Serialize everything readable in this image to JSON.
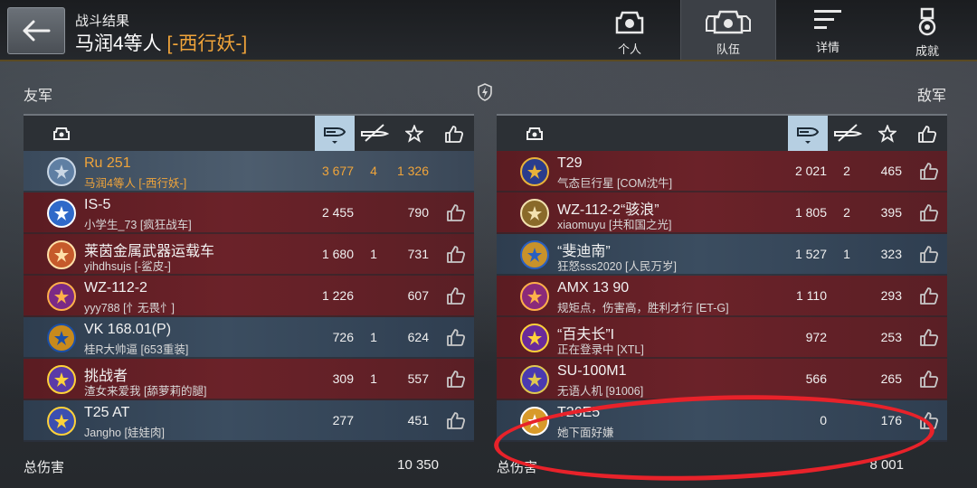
{
  "header": {
    "subtitle": "战斗结果",
    "title": "马润4等人",
    "title_clan": "[-西行妖-]"
  },
  "nav": [
    {
      "label": "个人",
      "icon": "personal-icon"
    },
    {
      "label": "队伍",
      "icon": "team-icon",
      "active": true
    },
    {
      "label": "详情",
      "icon": "details-icon"
    },
    {
      "label": "成就",
      "icon": "achievement-icon"
    }
  ],
  "allies": {
    "title": "友军",
    "rows": [
      {
        "tank": "Ru 251",
        "player": "马润4等人 [-西行妖-]",
        "damage": "3 677",
        "kills": "4",
        "xp": "1 326",
        "style": "gold"
      },
      {
        "tank": "IS-5",
        "player": "小学生_73 [疯狂战车]",
        "damage": "2 455",
        "kills": "",
        "xp": "790",
        "style": "red"
      },
      {
        "tank": "莱茵金属武器运载车",
        "player": "yihdhsujs [-鲨皮-]",
        "damage": "1 680",
        "kills": "1",
        "xp": "731",
        "style": "red"
      },
      {
        "tank": "WZ-112-2",
        "player": "yyy788 [忄无畏忄]",
        "damage": "1 226",
        "kills": "",
        "xp": "607",
        "style": "red"
      },
      {
        "tank": "VK 168.01(P)",
        "player": "桂R大帅逼 [653重装]",
        "damage": "726",
        "kills": "1",
        "xp": "624",
        "style": "blue"
      },
      {
        "tank": "挑战者",
        "player": "渣女来爱我 [舔萝莉的腿]",
        "damage": "309",
        "kills": "1",
        "xp": "557",
        "style": "red"
      },
      {
        "tank": "T25 AT",
        "player": "Jangho [娃娃肉]",
        "damage": "277",
        "kills": "",
        "xp": "451",
        "style": "blue"
      }
    ],
    "total_label": "总伤害",
    "total_value": "10 350"
  },
  "enemies": {
    "title": "敌军",
    "rows": [
      {
        "tank": "T29",
        "player": "气态巨行星 [COM沈牛]",
        "damage": "2 021",
        "kills": "2",
        "xp": "465",
        "style": "red"
      },
      {
        "tank": "WZ-112-2“骇浪”",
        "player": "xiaomuyu [共和国之光]",
        "damage": "1 805",
        "kills": "2",
        "xp": "395",
        "style": "red"
      },
      {
        "tank": "“斐迪南”",
        "player": "狂怒sss2020 [人民万岁]",
        "damage": "1 527",
        "kills": "1",
        "xp": "323",
        "style": "blue"
      },
      {
        "tank": "AMX 13 90",
        "player": "规矩点，伤害高，胜利才行 [ET-G]",
        "damage": "1 110",
        "kills": "",
        "xp": "293",
        "style": "red"
      },
      {
        "tank": "“百夫长”I",
        "player": "正在登录中 [XTL]",
        "damage": "972",
        "kills": "",
        "xp": "253",
        "style": "red"
      },
      {
        "tank": "SU-100M1",
        "player": "无语人机 [91006]",
        "damage": "566",
        "kills": "",
        "xp": "265",
        "style": "red"
      },
      {
        "tank": "T26E5",
        "player": "她下面好嫌",
        "damage": "0",
        "kills": "",
        "xp": "176",
        "style": "blue"
      }
    ],
    "total_label": "总伤害",
    "total_value": "8 001"
  },
  "colors": {
    "accent": "#f0a43a",
    "annotation": "#e8222a",
    "active_col": "#b6cfe2"
  }
}
